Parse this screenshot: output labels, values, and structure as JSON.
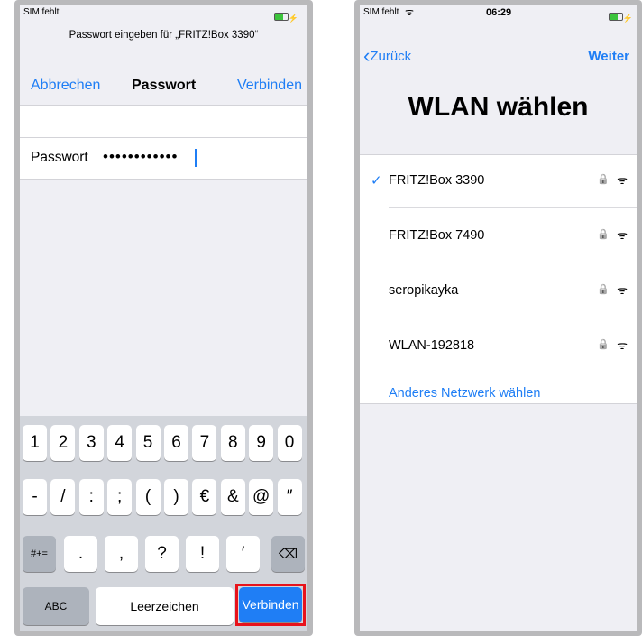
{
  "left_phone": {
    "status": {
      "carrier": "SIM fehlt"
    },
    "prompt": "Passwort eingeben für „FRITZ!Box 3390“",
    "nav": {
      "cancel": "Abbrechen",
      "title": "Passwort",
      "connect": "Verbinden"
    },
    "password_field": {
      "label": "Passwort",
      "value": "••••••••••••"
    },
    "keyboard": {
      "row1": [
        "1",
        "2",
        "3",
        "4",
        "5",
        "6",
        "7",
        "8",
        "9",
        "0"
      ],
      "row2": [
        "-",
        "/",
        ":",
        ";",
        "(",
        ")",
        "€",
        "&",
        "@",
        "″"
      ],
      "row3": [
        ".",
        ",",
        "?",
        "!",
        "′"
      ],
      "symbols_key": "#+=",
      "abc_key": "ABC",
      "space_key": "Leerzeichen",
      "return_key": "Verbinden"
    }
  },
  "right_phone": {
    "status": {
      "carrier": "SIM fehlt",
      "time": "06:29"
    },
    "nav": {
      "back": "Zurück",
      "next": "Weiter"
    },
    "title": "WLAN wählen",
    "networks": [
      {
        "name": "FRITZ!Box 3390",
        "selected": true
      },
      {
        "name": "FRITZ!Box 7490",
        "selected": false
      },
      {
        "name": "seropikayka",
        "selected": false
      },
      {
        "name": "WLAN-192818",
        "selected": false
      }
    ],
    "other_network": "Anderes Netzwerk wählen"
  },
  "colors": {
    "accent": "#1f7ef5",
    "highlight": "#e8131b"
  }
}
